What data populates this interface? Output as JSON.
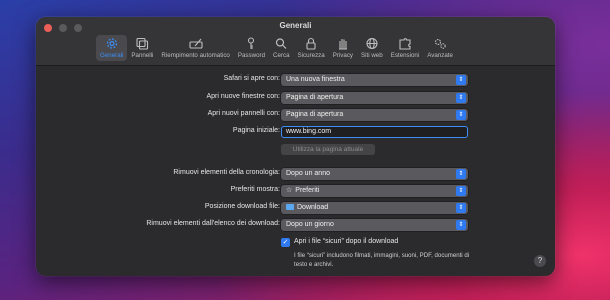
{
  "window": {
    "title": "Generali"
  },
  "toolbar": [
    {
      "label": "Generali",
      "icon": "gear-icon",
      "active": true
    },
    {
      "label": "Pannelli",
      "icon": "tabs-icon"
    },
    {
      "label": "Riempimento automatico",
      "icon": "pencil-field-icon"
    },
    {
      "label": "Password",
      "icon": "key-icon"
    },
    {
      "label": "Cerca",
      "icon": "search-icon"
    },
    {
      "label": "Sicurezza",
      "icon": "lock-icon"
    },
    {
      "label": "Privacy",
      "icon": "hand-icon"
    },
    {
      "label": "Siti web",
      "icon": "globe-icon"
    },
    {
      "label": "Estensioni",
      "icon": "puzzle-icon"
    },
    {
      "label": "Avanzate",
      "icon": "gears-icon"
    }
  ],
  "settings": {
    "safari_opens_label": "Safari si apre con:",
    "safari_opens_value": "Una nuova finestra",
    "new_windows_label": "Apri nuove finestre con:",
    "new_windows_value": "Pagina di apertura",
    "new_tabs_label": "Apri nuovi pannelli con:",
    "new_tabs_value": "Pagina di apertura",
    "homepage_label": "Pagina iniziale:",
    "homepage_value": "www.bing.com",
    "use_current_page": "Utilizza la pagina attuale",
    "history_label": "Rimuovi elementi della cronologia:",
    "history_value": "Dopo un anno",
    "favorites_label": "Preferiti mostra:",
    "favorites_value": "Preferiti",
    "favorites_icon": "☆",
    "download_location_label": "Posizione download file:",
    "download_location_value": "Download",
    "remove_downloads_label": "Rimuovi elementi dall'elenco dei download:",
    "remove_downloads_value": "Dopo un giorno",
    "safe_files_label": "Apri i file “sicuri” dopo il download",
    "safe_files_checked": true,
    "safe_files_note": "I file “sicuri” includono filmati, immagini, suoni, PDF, documenti di testo e archivi."
  },
  "help": "?",
  "colors": {
    "accent": "#2f7af0",
    "active_tab": "#3d8ef5"
  }
}
